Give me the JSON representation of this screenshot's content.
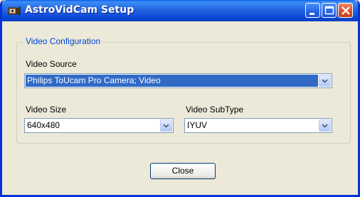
{
  "window": {
    "title": "AstroVidCam Setup",
    "icons": {
      "app": "camera-app-icon",
      "minimize": "minimize-icon",
      "maximize": "maximize-icon",
      "close": "close-icon"
    }
  },
  "group": {
    "title": "Video Configuration"
  },
  "video_source": {
    "label": "Video Source",
    "value": "Philips ToUcam Pro Camera; Video"
  },
  "video_size": {
    "label": "Video Size",
    "value": "640x480"
  },
  "video_subtype": {
    "label": "Video SubType",
    "value": "IYUV"
  },
  "buttons": {
    "close": "Close"
  },
  "colors": {
    "titlebar": "#0a4fd9",
    "accent": "#0046d5",
    "selection": "#316ac5",
    "background": "#ece9d8"
  }
}
